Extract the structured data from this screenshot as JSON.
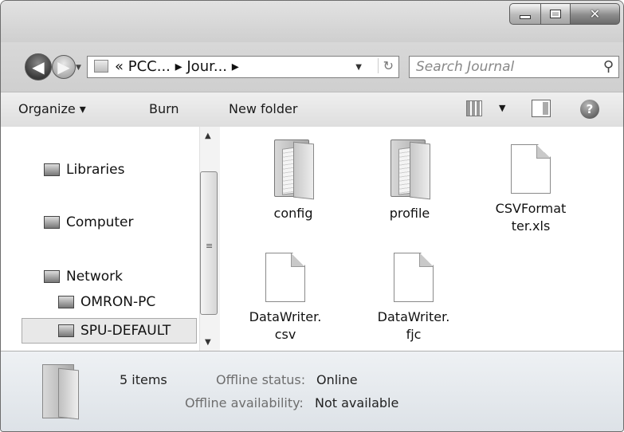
{
  "address": {
    "crumbs": "« PCC... ▸ Jour... ▸"
  },
  "search": {
    "placeholder": "Search Journal"
  },
  "toolbar": {
    "organize": "Organize ▾",
    "burn": "Burn",
    "new_folder": "New folder"
  },
  "nav": {
    "libraries": "Libraries",
    "computer": "Computer",
    "network": "Network",
    "omron_pc": "OMRON-PC",
    "spu_default": "SPU-DEFAULT"
  },
  "files": [
    {
      "name": "config",
      "type": "folder"
    },
    {
      "name": "profile",
      "type": "folder"
    },
    {
      "name": "CSVFormat\nter.xls",
      "type": "file"
    },
    {
      "name": "DataWriter.\ncsv",
      "type": "file"
    },
    {
      "name": "DataWriter.\nfjc",
      "type": "file"
    }
  ],
  "details": {
    "count": "5 items",
    "status_label": "Offline status:",
    "status_value": "Online",
    "avail_label": "Offline availability:",
    "avail_value": "Not available"
  }
}
